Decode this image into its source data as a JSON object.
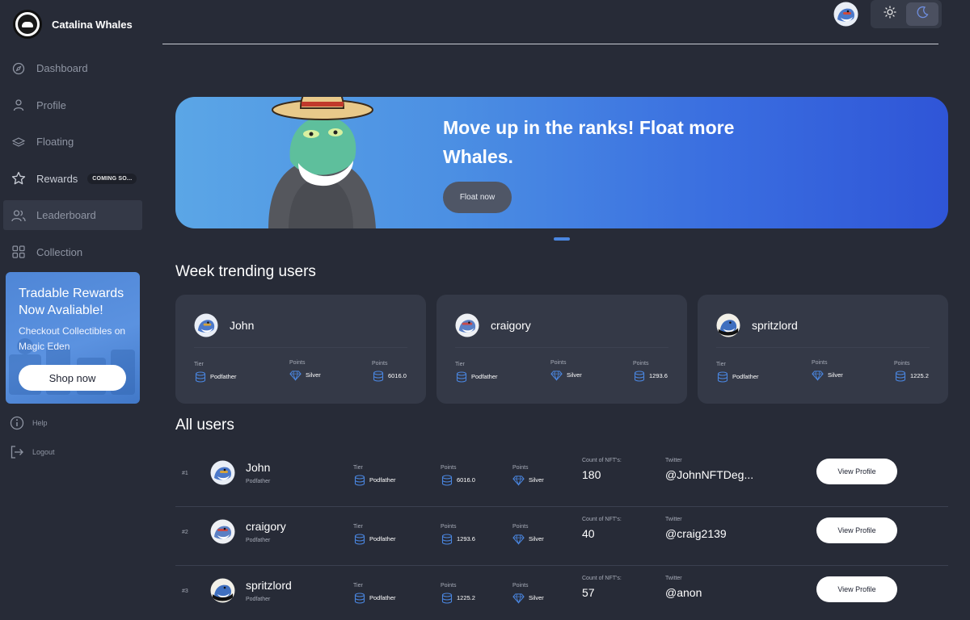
{
  "brand": {
    "name": "Catalina Whales",
    "logo_icon": "whale-logo-icon"
  },
  "nav": [
    {
      "label": "Dashboard",
      "icon": "compass-icon"
    },
    {
      "label": "Profile",
      "icon": "user-icon"
    },
    {
      "label": "Floating",
      "icon": "layers-icon"
    },
    {
      "label": "Rewards",
      "icon": "star-icon",
      "badge": "COMING SO..."
    },
    {
      "label": "Leaderboard",
      "icon": "users-icon",
      "active": true
    },
    {
      "label": "Collection",
      "icon": "grid-icon"
    }
  ],
  "promo": {
    "title": "Tradable Rewards Now Avaliable!",
    "subtitle": "Checkout Collectibles on Magic Eden",
    "button": "Shop now"
  },
  "bottom_nav": {
    "help": "Help",
    "logout": "Logout"
  },
  "hero": {
    "title": "Move up in the ranks! Float more Whales.",
    "button": "Float now"
  },
  "trending": {
    "title": "Week trending users",
    "cards": [
      {
        "name": "John",
        "tier_label": "Tier",
        "tier": "Podfather",
        "rank_label": "Points",
        "rank": "Silver",
        "points_label": "Points",
        "points": "6016.0"
      },
      {
        "name": "craigory",
        "tier_label": "Tier",
        "tier": "Podfather",
        "rank_label": "Points",
        "rank": "Silver",
        "points_label": "Points",
        "points": "1293.6"
      },
      {
        "name": "spritzlord",
        "tier_label": "Tier",
        "tier": "Podfather",
        "rank_label": "Points",
        "rank": "Silver",
        "points_label": "Points",
        "points": "1225.2"
      }
    ]
  },
  "all_users": {
    "title": "All users",
    "rows": [
      {
        "rank": "#1",
        "name": "John",
        "sub": "Podfather",
        "tier_label": "Tier",
        "tier": "Podfather",
        "points_label": "Points",
        "points": "6016.0",
        "rank_label": "Points",
        "level": "Silver",
        "count_label": "Count of NFT's:",
        "count": "180",
        "twitter_label": "Twitter",
        "twitter": "@JohnNFTDeg...",
        "button": "View Profile"
      },
      {
        "rank": "#2",
        "name": "craigory",
        "sub": "Podfather",
        "tier_label": "Tier",
        "tier": "Podfather",
        "points_label": "Points",
        "points": "1293.6",
        "rank_label": "Points",
        "level": "Silver",
        "count_label": "Count of NFT's:",
        "count": "40",
        "twitter_label": "Twitter",
        "twitter": "@craig2139",
        "button": "View Profile"
      },
      {
        "rank": "#3",
        "name": "spritzlord",
        "sub": "Podfather",
        "tier_label": "Tier",
        "tier": "Podfather",
        "points_label": "Points",
        "points": "1225.2",
        "rank_label": "Points",
        "level": "Silver",
        "count_label": "Count of NFT's:",
        "count": "57",
        "twitter_label": "Twitter",
        "twitter": "@anon",
        "button": "View Profile"
      }
    ]
  },
  "colors": {
    "background": "#272b37",
    "card": "#343947",
    "accent": "#3a6ee0",
    "icon_blue": "#4a86e0"
  }
}
